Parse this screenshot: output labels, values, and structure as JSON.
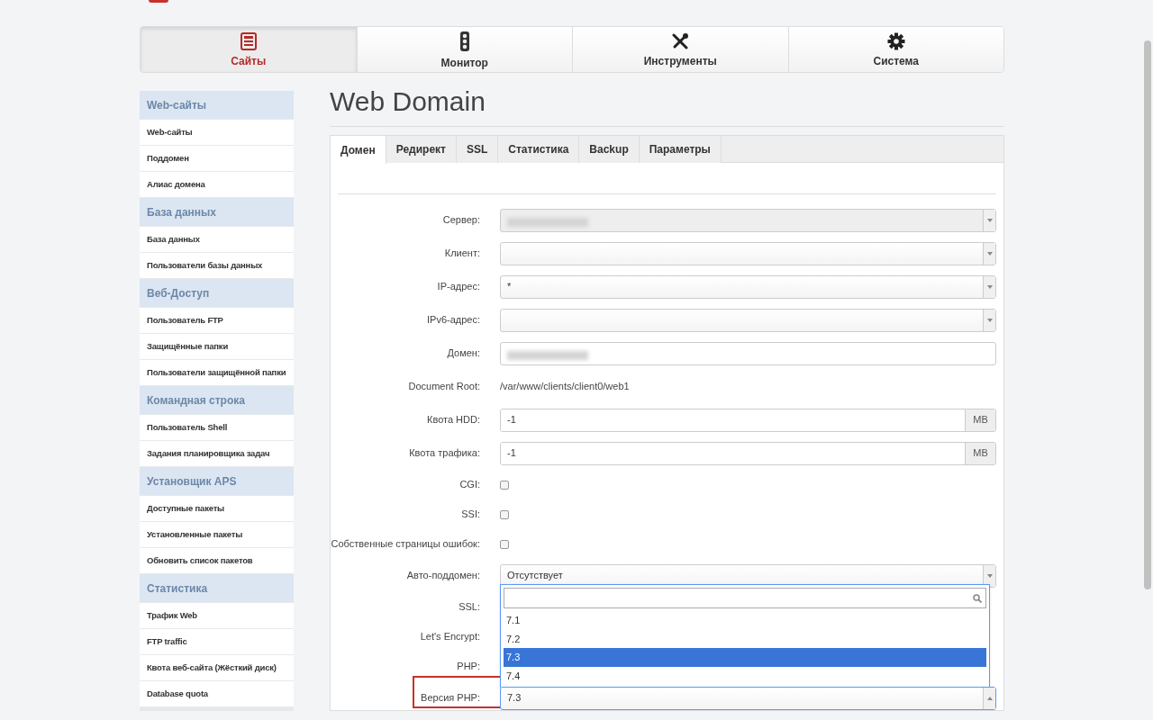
{
  "nav": [
    {
      "label": "Сайты",
      "selected": true
    },
    {
      "label": "Монитор",
      "selected": false
    },
    {
      "label": "Инструменты",
      "selected": false
    },
    {
      "label": "Система",
      "selected": false
    }
  ],
  "sidebar": [
    {
      "title": "Web-сайты",
      "items": [
        "Web-сайты",
        "Поддомен",
        "Алиас домена"
      ]
    },
    {
      "title": "База данных",
      "items": [
        "База данных",
        "Пользователи базы данных"
      ]
    },
    {
      "title": "Веб-Доступ",
      "items": [
        "Пользователь FTP",
        "Защищённые папки",
        "Пользователи защищённой папки"
      ]
    },
    {
      "title": "Командная строка",
      "items": [
        "Пользователь Shell",
        "Задания планировщика задач"
      ]
    },
    {
      "title": "Установщик APS",
      "items": [
        "Доступные пакеты",
        "Установленные пакеты",
        "Обновить список пакетов"
      ]
    },
    {
      "title": "Статистика",
      "items": [
        "Трафик Web",
        "FTP traffic",
        "Квота веб-сайта (Жёсткий диск)",
        "Database quota"
      ]
    }
  ],
  "heading": "Web Domain",
  "tabs": [
    {
      "label": "Домен",
      "selected": true
    },
    {
      "label": "Редирект",
      "selected": false
    },
    {
      "label": "SSL",
      "selected": false
    },
    {
      "label": "Статистика",
      "selected": false
    },
    {
      "label": "Backup",
      "selected": false
    },
    {
      "label": "Параметры",
      "selected": false
    }
  ],
  "form": [
    {
      "label": "Сервер:",
      "kind": "select",
      "redacted": true,
      "disabled": true
    },
    {
      "label": "Клиент:",
      "kind": "select"
    },
    {
      "label": "IP-адрес:",
      "kind": "select",
      "value": "*"
    },
    {
      "label": "IPv6-адрес:",
      "kind": "select"
    },
    {
      "label": "Домен:",
      "kind": "text",
      "redacted": true
    },
    {
      "label": "Document Root:",
      "kind": "static",
      "value": "/var/www/clients/client0/web1"
    },
    {
      "label": "Квота HDD:",
      "kind": "addon",
      "value": "-1",
      "addon": "MB"
    },
    {
      "label": "Квота трафика:",
      "kind": "addon",
      "value": "-1",
      "addon": "MB"
    },
    {
      "label": "CGI:",
      "kind": "checkbox",
      "checked": false
    },
    {
      "label": "SSI:",
      "kind": "checkbox",
      "checked": false
    },
    {
      "label": "Собственные страницы ошибок:",
      "kind": "checkbox",
      "checked": false
    },
    {
      "label": "Авто-поддомен:",
      "kind": "select",
      "value": "Отсутствует"
    },
    {
      "label": "SSL:",
      "kind": "covered"
    },
    {
      "label": "Let's Encrypt:",
      "kind": "covered"
    },
    {
      "label": "PHP:",
      "kind": "covered"
    },
    {
      "label": "Версия PHP:",
      "kind": "select",
      "value": "7.3",
      "open": true,
      "highlighted": true,
      "options": [
        {
          "label": "7.1",
          "selected": false
        },
        {
          "label": "7.2",
          "selected": false
        },
        {
          "label": "7.3",
          "selected": true
        },
        {
          "label": "7.4",
          "selected": false
        }
      ]
    }
  ]
}
